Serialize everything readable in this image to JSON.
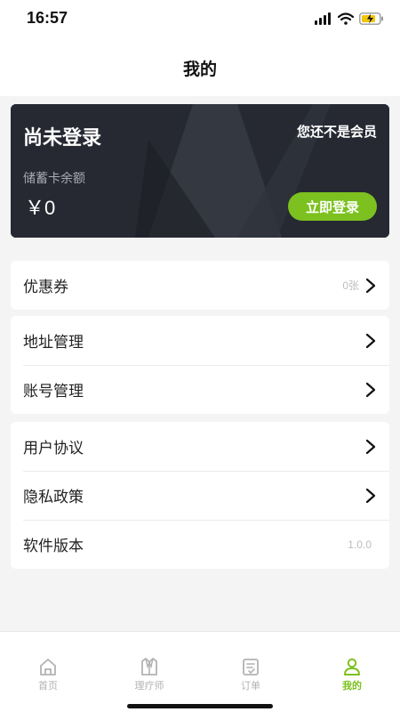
{
  "status": {
    "time": "16:57"
  },
  "nav": {
    "title": "我的"
  },
  "account_card": {
    "title": "尚未登录",
    "member_status": "您还不是会员",
    "balance_label": "储蓄卡余额",
    "balance": "￥0",
    "login_button": "立即登录"
  },
  "menu": {
    "coupon": {
      "label": "优惠券",
      "value": "0张"
    },
    "address": {
      "label": "地址管理"
    },
    "account": {
      "label": "账号管理"
    },
    "user_agreement": {
      "label": "用户协议"
    },
    "privacy": {
      "label": "隐私政策"
    },
    "version": {
      "label": "软件版本",
      "value": "1.0.0"
    }
  },
  "tabbar": {
    "items": [
      {
        "label": "首页",
        "icon": "home-icon"
      },
      {
        "label": "理疗师",
        "icon": "coat-icon"
      },
      {
        "label": "订单",
        "icon": "order-icon"
      },
      {
        "label": "我的",
        "icon": "person-icon",
        "active": true
      }
    ]
  },
  "colors": {
    "accent": "#7cc11f",
    "card_bg": "#262932",
    "page_bg": "#f4f4f5"
  }
}
